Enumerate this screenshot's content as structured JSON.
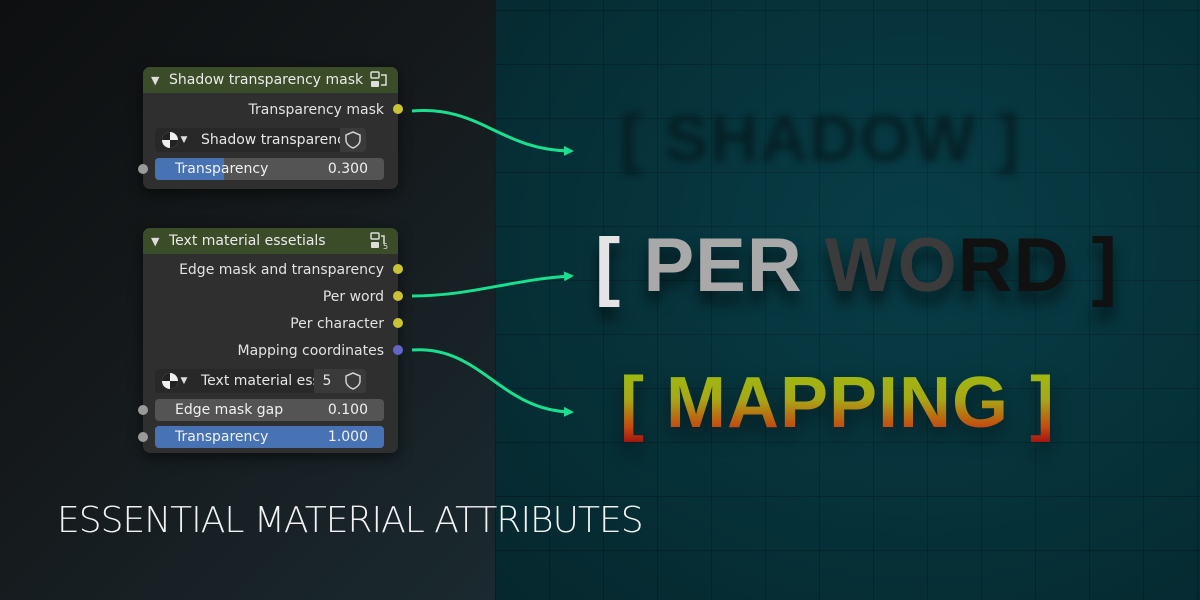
{
  "colors": {
    "accent_slider": "#4772b3",
    "socket_float": "#c9c435",
    "socket_vector": "#6266c9",
    "wire": "#19e08f",
    "group_header": "#3b4d28"
  },
  "node_shadow": {
    "title": "Shadow transparency mask",
    "outputs": [
      {
        "label": "Transparency mask",
        "socket": "float"
      }
    ],
    "group_selector": {
      "name": "Shadow transparency..."
    },
    "inputs": [
      {
        "label": "Transparency",
        "value": "0.300",
        "fraction": 0.3
      }
    ]
  },
  "node_text": {
    "title": "Text material essetials",
    "header_badge": "5",
    "outputs": [
      {
        "label": "Edge mask and transparency",
        "socket": "float"
      },
      {
        "label": "Per word",
        "socket": "float"
      },
      {
        "label": "Per character",
        "socket": "float"
      },
      {
        "label": "Mapping coordinates",
        "socket": "vector"
      }
    ],
    "group_selector": {
      "name": "Text material ess...",
      "users": "5"
    },
    "inputs": [
      {
        "label": "Edge mask gap",
        "value": "0.100",
        "fraction": 0.0
      },
      {
        "label": "Transparency",
        "value": "1.000",
        "fraction": 1.0
      }
    ]
  },
  "preview": {
    "shadow": "[ SHADOW ]",
    "per_word": "[ PER WORD ]",
    "per_word_parts": [
      "[ ",
      "PER",
      " WO",
      "RD",
      " ]"
    ],
    "mapping": "[ MAPPING ]"
  },
  "caption": "ESSENTIAL MATERIAL ATTRIBUTES",
  "icons": {
    "collapse": "chevron-down-icon",
    "group": "node-group-icon",
    "material_sphere": "sphere-icon",
    "fake_user": "shield-icon"
  }
}
